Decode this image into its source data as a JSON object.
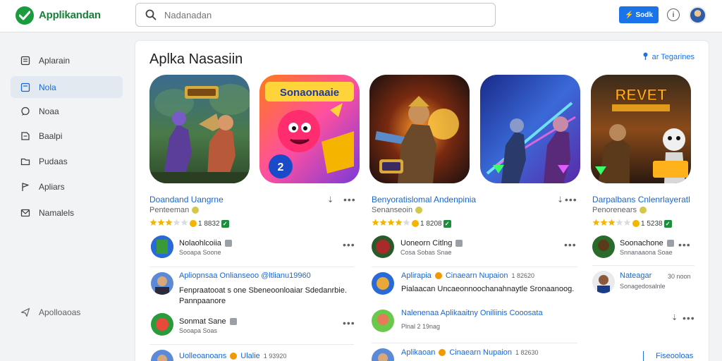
{
  "header": {
    "app_title": "Applikandan",
    "search_placeholder": "Nadanadan",
    "primary_button": "Sodk",
    "brand_color": "#188038",
    "accent_color": "#1a73e8"
  },
  "sidebar": {
    "items": [
      {
        "label": "Aplarain",
        "icon": "home-icon",
        "active": false
      },
      {
        "label": "Nola",
        "icon": "grid-icon",
        "active": true
      },
      {
        "label": "Noaa",
        "icon": "chat-icon",
        "active": false
      },
      {
        "label": "Baalpi",
        "icon": "doc-icon",
        "active": false
      },
      {
        "label": "Pudaas",
        "icon": "folder-icon",
        "active": false
      },
      {
        "label": "Apliars",
        "icon": "flag-icon",
        "active": false
      },
      {
        "label": "Namalels",
        "icon": "mail-icon",
        "active": false
      }
    ],
    "footer": {
      "label": "Apolloaoas",
      "icon": "send-icon"
    }
  },
  "main": {
    "title": "Aplka Nasasiin",
    "link": "ar Tegarines",
    "tiles": [
      {
        "name": "tile-1",
        "text": ""
      },
      {
        "name": "tile-2",
        "text": "Sonaonaaie"
      },
      {
        "name": "tile-3",
        "text": ""
      },
      {
        "name": "tile-4",
        "text": ""
      },
      {
        "name": "tile-5",
        "text": "REVET"
      }
    ],
    "games": [
      {
        "name": "Doandand Uangrne",
        "developer": "Penteeman",
        "rating": "1 8832",
        "stars_filled": 3
      },
      {
        "name": "Benyoratislomal Andenpinia",
        "developer": "Senanseoin",
        "rating": "1 8208",
        "stars_filled": 4
      },
      {
        "name": "Darpalbans Cnlenrlayeratl",
        "developer": "Penorenears",
        "rating": "1 5238",
        "stars_filled": 3
      }
    ],
    "feed_left": [
      {
        "title": "Nolaohlcoiia",
        "sub": "Sooapa Soone"
      },
      {
        "title": "Apliopnsaa Onlianseoo @ltlianu19960",
        "body1": "Fenpraatooat s one Sbeneoonloaiar Sdedanrbie.",
        "body2": "Pannpaanore"
      },
      {
        "title": "Sonmat Sane",
        "sub": "Sooapa Soas"
      },
      {
        "title": "Uolleoanoans",
        "extra": "Ulalie",
        "date": "1 93920"
      }
    ],
    "feed_mid": [
      {
        "title": "Uoneorn Citlng",
        "sub": "Cosa Sobas Snae"
      },
      {
        "title": "Aplirapia",
        "title2": "Cinaearn Nupaion",
        "date": "1 82620",
        "body1": "Pialaacan Uncaeonnoochanahnaytle Sronaanoog."
      },
      {
        "title": "Nalenenaa Aplikaaitny Oniliinis Cooosata",
        "sub": "Plnal 2 19nag"
      },
      {
        "title": "Aplikaoan",
        "title2": "Cinaearn Nupaion",
        "date": "1 82630"
      }
    ],
    "feed_right": [
      {
        "title": "Soonachone",
        "sub": "Snnanaaona Soae"
      },
      {
        "title": "Nateagar",
        "date": "30 noon",
        "sub": "Sonagedosalnle"
      },
      {
        "title": "Fiseooloas"
      }
    ]
  }
}
